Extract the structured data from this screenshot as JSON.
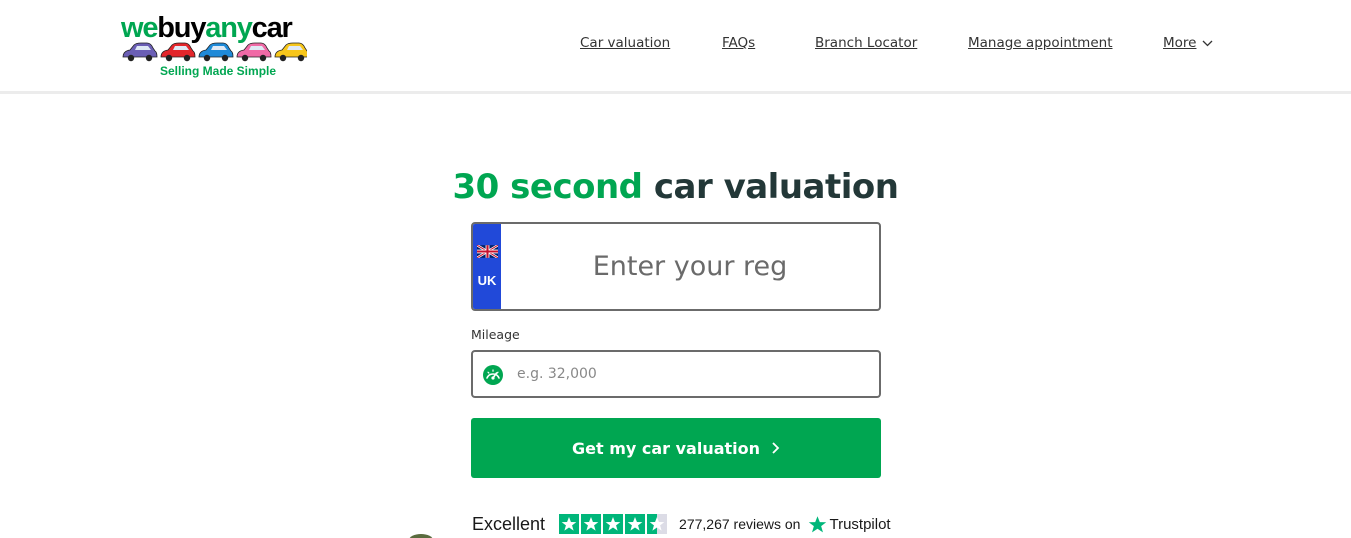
{
  "header": {
    "logo": {
      "word_we": "we",
      "word_buy": "buy",
      "word_any": "any",
      "word_car": "car",
      "tagline": "Selling Made Simple",
      "car_colors": [
        "#6b5fb5",
        "#e3262b",
        "#1f8ad8",
        "#f06aa6",
        "#f7c61b"
      ]
    },
    "nav": {
      "car_valuation": "Car valuation",
      "faqs": "FAQs",
      "branch_locator": "Branch Locator",
      "manage_appointment": "Manage appointment",
      "more": "More"
    }
  },
  "hero": {
    "title_green": "30 second",
    "title_dark": "car valuation"
  },
  "reg": {
    "country": "UK",
    "placeholder": "Enter your reg",
    "value": ""
  },
  "mileage": {
    "label": "Mileage",
    "placeholder": "e.g. 32,000",
    "value": ""
  },
  "cta": {
    "label": "Get my car valuation"
  },
  "trustpilot": {
    "rating_text": "Excellent",
    "stars": 4.5,
    "reviews_text": "277,267 reviews on",
    "brand": "Trustpilot"
  },
  "colors": {
    "brand_green": "#00a651",
    "title_dark": "#233838",
    "reg_blue": "#2149d9",
    "trustpilot_green": "#00b67a"
  },
  "icons": {
    "flag": "uk-flag-icon",
    "mileage": "speedometer-icon",
    "cta": "chevron-right-icon",
    "more": "chevron-down-icon",
    "trustpilot": "star-icon"
  }
}
